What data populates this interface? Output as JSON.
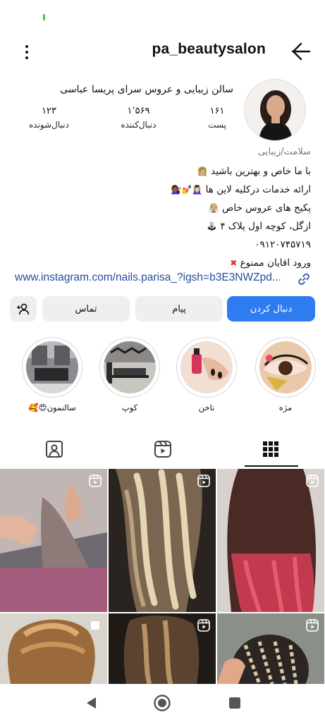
{
  "header": {
    "username": "pa_beautysalon"
  },
  "profile": {
    "full_name": "سالن زیبایی و عروس سرای پریسا عباسی",
    "stats": [
      {
        "value": "۱۶۱",
        "label": "پست"
      },
      {
        "value": "۱٬۵۶۹",
        "label": "دنبال‌کننده"
      },
      {
        "value": "۱۲۳",
        "label": "دنبال‌شونده"
      }
    ]
  },
  "bio": {
    "category": "سلامت/زیبایی",
    "lines": [
      "با ما خاص و بهترین باشید",
      "ارائه خدمات درکلیه لاین ها",
      "پکیج های عروس خاص",
      "ازگل، کوچه اول پلاک ۴",
      "۰۹۱۲۰۷۴۵۷۱۹",
      "ورود اقایان ممنوع"
    ],
    "link": "www.instagram.com/nails.parisa_?igsh=b3E3NWZpd..."
  },
  "buttons": {
    "follow": "دنبال کردن",
    "message": "پیام",
    "contact": "تماس"
  },
  "highlights": [
    {
      "label": "مژه"
    },
    {
      "label": "ناخن"
    },
    {
      "label": "کوپ"
    },
    {
      "label": "سالنمون😍🥰"
    }
  ],
  "tabs": [
    "grid",
    "reels",
    "tagged"
  ],
  "icons": {
    "more": "more-vertical-icon",
    "back": "arrow-right-icon",
    "link": "link-icon",
    "add_user": "add-user-icon",
    "reel": "reel-icon"
  },
  "colors": {
    "follow_button": "#2f7bf0",
    "link_text": "#2a4a9b",
    "secondary_button": "#efefef"
  }
}
